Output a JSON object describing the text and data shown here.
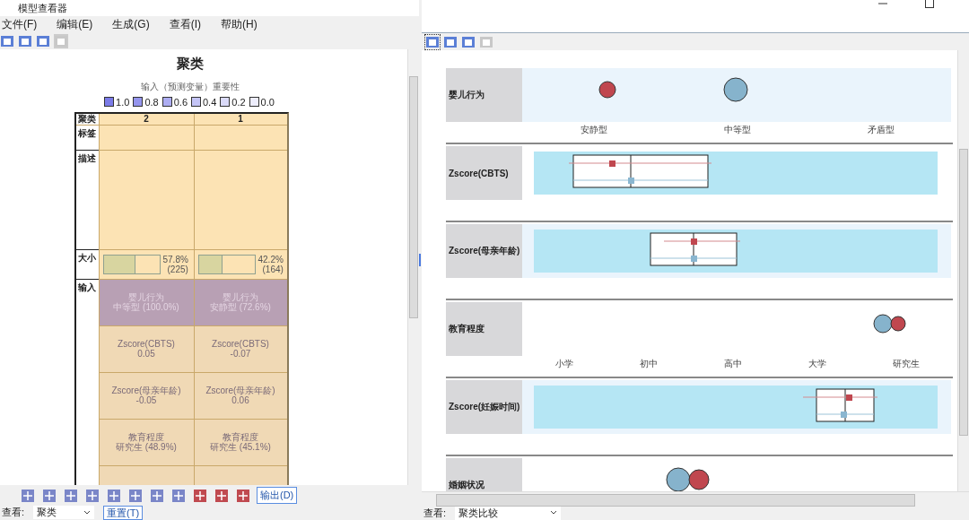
{
  "window": {
    "title": "模型查看器"
  },
  "menu": [
    {
      "label": "文件(F)"
    },
    {
      "label": "编辑(E)"
    },
    {
      "label": "生成(G)"
    },
    {
      "label": "查看(I)"
    },
    {
      "label": "帮助(H)"
    }
  ],
  "left_panel": {
    "title": "聚类",
    "subtitle": "输入（预测变量）重要性",
    "legend": [
      {
        "label": "1.0",
        "color": "#7b7be8"
      },
      {
        "label": "0.8",
        "color": "#9595ee"
      },
      {
        "label": "0.6",
        "color": "#adadf2"
      },
      {
        "label": "0.4",
        "color": "#c4c4f6"
      },
      {
        "label": "0.2",
        "color": "#dadaf9"
      },
      {
        "label": "0.0",
        "color": "#ededfc"
      }
    ],
    "table": {
      "corner": "聚类",
      "columns": [
        "2",
        "1"
      ],
      "label_row": "标签",
      "description_row": "描述",
      "size_row": "大小",
      "inputs_row": "输入",
      "sizes": [
        {
          "level": 0.578,
          "percent": "57.8%",
          "count": "(225)"
        },
        {
          "level": 0.422,
          "percent": "42.2%",
          "count": "(164)"
        }
      ],
      "inputs": [
        [
          {
            "lines": [
              "婴儿行为",
              "中等型 (100.0%)"
            ],
            "color": "#b8a0b4",
            "highlighted": true
          },
          {
            "lines": [
              "婴儿行为",
              "安静型 (72.6%)"
            ],
            "color": "#b8a0b4",
            "highlighted": true
          }
        ],
        [
          {
            "lines": [
              "Zscore(CBTS)",
              "0.05"
            ],
            "color": "#f0d9b5",
            "highlighted": false
          },
          {
            "lines": [
              "Zscore(CBTS)",
              "-0.07"
            ],
            "color": "#f0d9b5",
            "highlighted": false
          }
        ],
        [
          {
            "lines": [
              "Zscore(母亲年龄)",
              "-0.05"
            ],
            "color": "#f0d9b5",
            "highlighted": false
          },
          {
            "lines": [
              "Zscore(母亲年龄)",
              "0.06"
            ],
            "color": "#f0d9b5",
            "highlighted": false
          }
        ],
        [
          {
            "lines": [
              "教育程度",
              "研究生 (48.9%)"
            ],
            "color": "#f0d9b5",
            "highlighted": false
          },
          {
            "lines": [
              "教育程度",
              "研究生 (45.1%)"
            ],
            "color": "#f0d9b5",
            "highlighted": false
          }
        ],
        [
          {
            "color": "#f0d9b5"
          },
          {
            "color": "#f0d9b5"
          }
        ]
      ]
    }
  },
  "bottom_toolbar": {
    "output_button": "输出(D)"
  },
  "left_view": {
    "label": "查看:",
    "value": "聚类",
    "reset_button": "重置(T)"
  },
  "right_panel": {
    "rows": [
      {
        "kind": "categorical",
        "label": "婴儿行为",
        "shaded": true,
        "categories": [
          "安静型",
          "中等型",
          "矛盾型"
        ]
      },
      {
        "kind": "boxplot",
        "label": "Zscore(CBTS)",
        "shaded": false
      },
      {
        "kind": "boxplot",
        "label": "Zscore(母亲年龄)",
        "shaded": true
      },
      {
        "kind": "categorical",
        "label": "教育程度",
        "shaded": false,
        "categories": [
          "小学",
          "初中",
          "高中",
          "大学",
          "研究生"
        ]
      },
      {
        "kind": "boxplot",
        "label": "Zscore(妊娠时间)",
        "shaded": true
      },
      {
        "kind": "categorical",
        "label": "婚姻状况",
        "shaded": false
      }
    ],
    "view": {
      "label": "查看:",
      "value": "聚类比较"
    }
  }
}
